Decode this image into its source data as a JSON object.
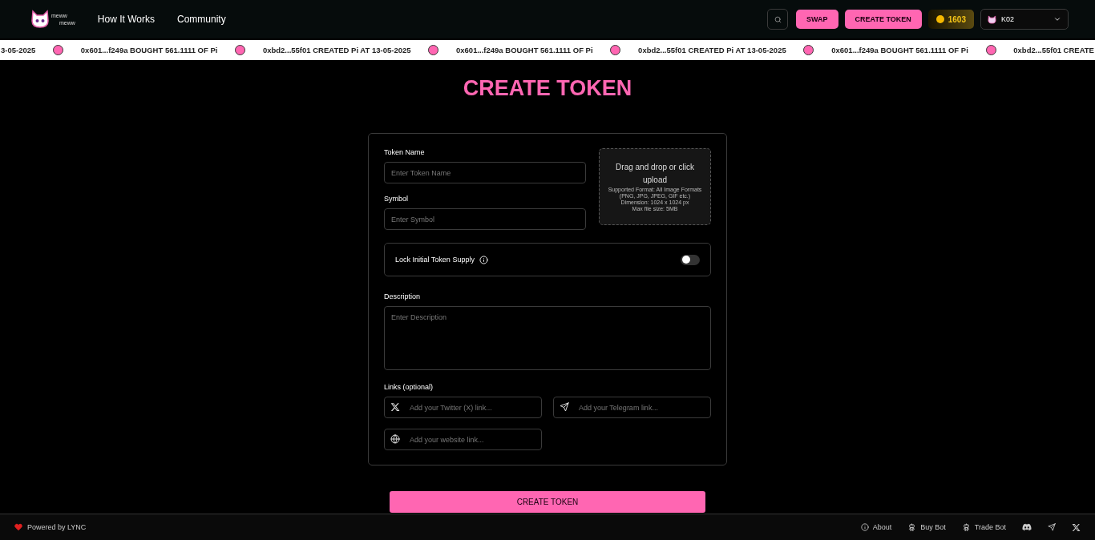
{
  "header": {
    "logo_text": [
      "meww",
      "meww"
    ],
    "nav": [
      "How It Works",
      "Community"
    ],
    "swap_button": "SWAP",
    "create_button": "CREATE TOKEN",
    "balance": "1603",
    "account": "K02"
  },
  "ticker": [
    "3-05-2025",
    "0x601...f249a BOUGHT 561.1111 OF Pi",
    "0xbd2...55f01 CREATED Pi AT 13-05-2025",
    "0x601...f249a BOUGHT 561.1111 OF Pi",
    "0xbd2...55f01 CREATED Pi AT 13-05-2025",
    "0x601...f249a BOUGHT 561.1111 OF Pi",
    "0xbd2...55f01 CREATE"
  ],
  "page_title": "CREATE TOKEN",
  "form": {
    "token_name": {
      "label": "Token Name",
      "placeholder": "Enter Token Name"
    },
    "symbol": {
      "label": "Symbol",
      "placeholder": "Enter Symbol"
    },
    "upload": {
      "title": "Drag and drop or click upload",
      "details": [
        "Supported Format: All Image Formats",
        "(PNG, JPG, JPEG, GIF etc.)",
        "Dimension: 1024 x 1024 px",
        "Max file size: 5MB"
      ]
    },
    "lock_supply": {
      "label": "Lock Initial Token Supply",
      "on": false
    },
    "description": {
      "label": "Description",
      "placeholder": "Enter Description"
    },
    "links": {
      "label": "Links (optional)",
      "fields": [
        {
          "kind": "x",
          "placeholder": "Add your Twitter (X) link..."
        },
        {
          "kind": "telegram",
          "placeholder": "Add your Telegram link..."
        },
        {
          "kind": "web",
          "placeholder": "Add your website link..."
        }
      ]
    },
    "submit": "CREATE TOKEN"
  },
  "footer": {
    "powered": "Powered by LYNC",
    "links": [
      "About",
      "Buy Bot",
      "Trade Bot"
    ]
  }
}
